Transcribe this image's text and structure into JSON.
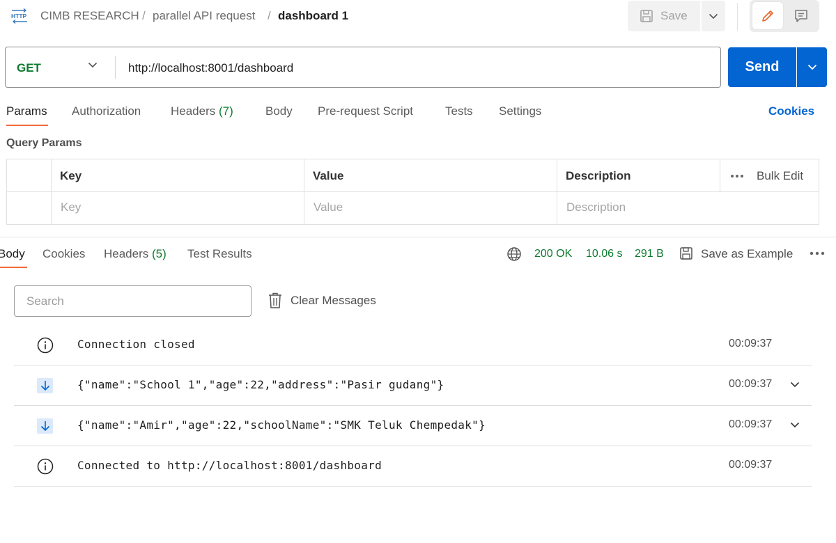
{
  "header": {
    "http_icon_label": "HTTP",
    "breadcrumb": [
      "CIMB RESEARCH",
      "parallel API request",
      "dashboard 1"
    ],
    "separator": "/",
    "save_label": "Save"
  },
  "request": {
    "method": "GET",
    "url": "http://localhost:8001/dashboard",
    "send_label": "Send"
  },
  "request_tabs": {
    "params": "Params",
    "authorization": "Authorization",
    "headers": "Headers",
    "headers_count": "(7)",
    "body": "Body",
    "pre_request": "Pre-request Script",
    "tests": "Tests",
    "settings": "Settings",
    "cookies": "Cookies"
  },
  "query_params": {
    "title": "Query Params",
    "columns": [
      "Key",
      "Value",
      "Description"
    ],
    "placeholders": [
      "Key",
      "Value",
      "Description"
    ],
    "bulk_edit": "Bulk Edit"
  },
  "response": {
    "tabs": {
      "body": "Body",
      "cookies": "Cookies",
      "headers": "Headers",
      "headers_count": "(5)",
      "test_results": "Test Results"
    },
    "status": "200 OK",
    "time": "10.06 s",
    "size": "291 B",
    "save_example": "Save as Example"
  },
  "messages": {
    "search_placeholder": "Search",
    "clear_label": "Clear Messages",
    "items": [
      {
        "type": "info",
        "text": "Connection closed",
        "time": "00:09:37"
      },
      {
        "type": "received",
        "text": "{\"name\":\"School 1\",\"age\":22,\"address\":\"Pasir gudang\"}",
        "time": "00:09:37"
      },
      {
        "type": "received",
        "text": "{\"name\":\"Amir\",\"age\":22,\"schoolName\":\"SMK Teluk Chempedak\"}",
        "time": "00:09:37"
      },
      {
        "type": "info",
        "text": "Connected to http://localhost:8001/dashboard",
        "time": "00:09:37"
      }
    ]
  },
  "colors": {
    "accent_blue": "#0265d2",
    "status_green": "#0d7a2f",
    "tab_underline": "#f26b3a"
  }
}
